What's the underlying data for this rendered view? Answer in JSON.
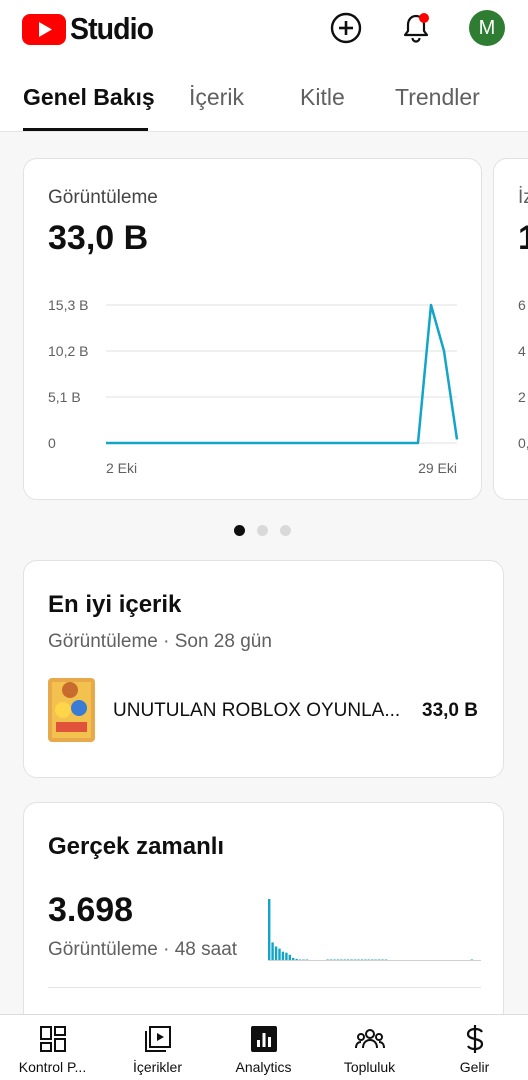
{
  "header": {
    "app_name": "Studio",
    "avatar_letter": "M",
    "colors": {
      "brand_red": "#ff0000",
      "avatar_bg": "#2e7d32",
      "notification_dot": "#ff0000"
    }
  },
  "tabs": [
    {
      "label": "Genel Bakış",
      "active": true
    },
    {
      "label": "İçerik",
      "active": false
    },
    {
      "label": "Kitle",
      "active": false
    },
    {
      "label": "Trendler",
      "active": false
    }
  ],
  "views_card": {
    "label": "Görüntüleme",
    "value": "33,0 B",
    "chart_data": {
      "type": "line",
      "series_color": "#13a5c7",
      "y_ticks": [
        "15,3 B",
        "10,2 B",
        "5,1 B",
        "0"
      ],
      "ylim": [
        0,
        15.3
      ],
      "x_labels": [
        "2 Eki",
        "29 Eki"
      ],
      "values": [
        0,
        0,
        0,
        0,
        0,
        0,
        0,
        0,
        0,
        0,
        0,
        0,
        0,
        0,
        0,
        0,
        0,
        0,
        0,
        0,
        0,
        0,
        0,
        0,
        0,
        15.3,
        10.2,
        0.4
      ]
    }
  },
  "peek_card": {
    "label_fragment": "İz",
    "value_fragment": "1",
    "tick_fragments": [
      "6",
      "4",
      "2",
      "0,"
    ]
  },
  "pager": {
    "count": 3,
    "active_index": 0
  },
  "top_content": {
    "title": "En iyi içerik",
    "subtitle": "Görüntüleme · Son 28 gün",
    "item": {
      "title": "UNUTULAN ROBLOX OYUNLA...",
      "value": "33,0 B"
    }
  },
  "realtime": {
    "title": "Gerçek zamanlı",
    "value": "3.698",
    "subtitle": "Görüntüleme · 48 saat",
    "bar_color": "#13a5c7",
    "bars": [
      60,
      18,
      14,
      12,
      9,
      8,
      6,
      3,
      2,
      1,
      1,
      1,
      0,
      0,
      0,
      0,
      0,
      1,
      1,
      1,
      1,
      1,
      1,
      1,
      1,
      1,
      1,
      1,
      1,
      1,
      1,
      1,
      1,
      1,
      1,
      0,
      0,
      0,
      0,
      0,
      0,
      0,
      0,
      0,
      0,
      0,
      0,
      0,
      0,
      0,
      0,
      0,
      0,
      0,
      0,
      0,
      0,
      0,
      0,
      1,
      0,
      0
    ]
  },
  "bottom_nav": [
    {
      "label": "Kontrol P...",
      "icon": "dashboard-icon"
    },
    {
      "label": "İçerikler",
      "icon": "content-icon"
    },
    {
      "label": "Analytics",
      "icon": "analytics-icon"
    },
    {
      "label": "Topluluk",
      "icon": "community-icon"
    },
    {
      "label": "Gelir",
      "icon": "earn-icon"
    }
  ]
}
